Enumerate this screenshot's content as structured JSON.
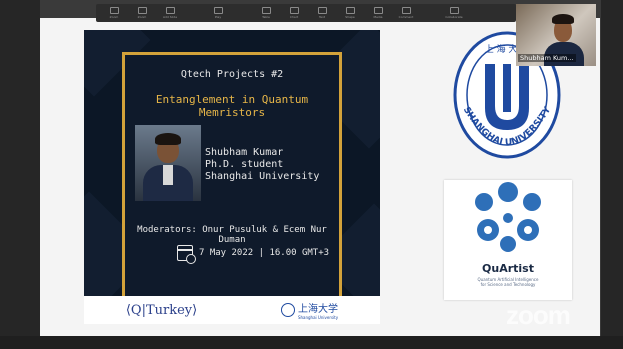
{
  "toolbar": {
    "items": [
      "Zoom",
      "Zoom",
      "Add Slide",
      "",
      "Play",
      "",
      "Table",
      "Chart",
      "Text",
      "Shape",
      "Media",
      "Comment",
      "",
      "Collaborate"
    ]
  },
  "poster": {
    "series": "Qtech Projects #2",
    "title": "Entanglement in Quantum Memristors",
    "speaker_name": "Shubham Kumar",
    "speaker_role": "Ph.D. student",
    "speaker_affiliation": "Shanghai University",
    "moderators": "Moderators: Onur Pusuluk & Ecem Nur Duman",
    "date": "7 May 2022 | 16.00 GMT+3",
    "footer_left": "⟨Q|Turkey⟩",
    "footer_right_cn": "上海大学",
    "footer_right_en": "Shanghai University"
  },
  "shu_logo": {
    "cn": "上 海 大 学",
    "en": "SHANGHAI UNIVERSITY"
  },
  "quartist": {
    "name": "QuArtist",
    "subtitle_line1": "Quantum Artificial Intelligence",
    "subtitle_line2": "for Science and Technology"
  },
  "camera": {
    "participant": "Shubham Kum..."
  },
  "watermark": "zoom",
  "colors": {
    "gold": "#d3a23a",
    "poster_bg": "#0c1726",
    "shu_blue": "#1f4aa0"
  }
}
